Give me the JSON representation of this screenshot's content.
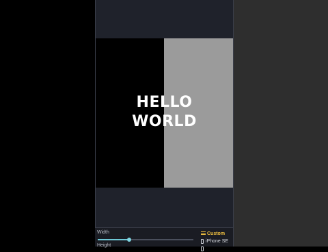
{
  "preview": {
    "text_line1": "HELLO",
    "text_line2": "WORLD"
  },
  "controls": {
    "width_label": "Width",
    "height_label": "Height",
    "width_slider_value": 0.33,
    "presets": [
      {
        "label": "Custom",
        "icon": "list-icon",
        "selected": true
      },
      {
        "label": "iPhone SE",
        "icon": "phone-icon",
        "selected": false
      }
    ]
  },
  "colors": {
    "accent": "#f0c040",
    "slider": "#6fc8d6",
    "panel": "#1d2029"
  }
}
